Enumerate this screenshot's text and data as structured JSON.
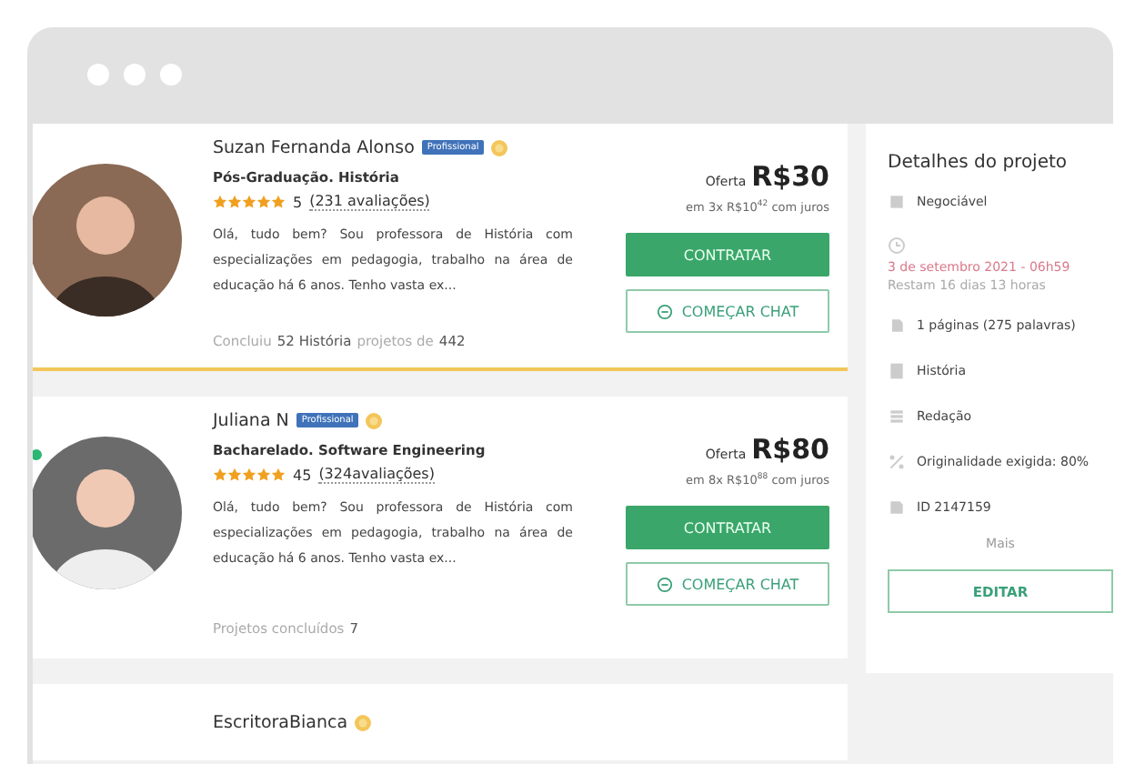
{
  "freelancers": [
    {
      "name": "Suzan Fernanda Alonso",
      "professional": true,
      "professional_label": "Profissional",
      "verified": true,
      "selected": true,
      "online": false,
      "degree": "Pós-Graduação. História",
      "stars": 5,
      "rating": "5",
      "reviews": "(231 avaliações)",
      "bio": "Olá, tudo bem? Sou professora de História com especializações em pedagogia, trabalho na área de educação há 6 anos. Tenho vasta ex...",
      "completed": [
        {
          "text": "Concluiu",
          "strong": false
        },
        {
          "text": "52 História",
          "strong": true
        },
        {
          "text": "projetos de",
          "strong": false
        },
        {
          "text": "442",
          "strong": true
        }
      ],
      "offer_label": "Oferta",
      "price": "R$30",
      "installments": "em 3x R$10$^{42}$ com juros",
      "hire": "CONTRATAR",
      "chat": "COMEÇAR CHAT"
    },
    {
      "name": "Juliana N",
      "professional": true,
      "professional_label": "Profissional",
      "verified": true,
      "selected": false,
      "online": true,
      "degree": "Bacharelado. Software Engineering",
      "stars": 5,
      "rating": "45",
      "reviews": "(324avaliações)",
      "bio": "Olá, tudo bem? Sou professora de História com especializações em pedagogia, trabalho na área de educação há 6 anos. Tenho vasta ex...",
      "completed": [
        {
          "text": "Projetos concluídos",
          "strong": false
        },
        {
          "text": "7",
          "strong": true
        }
      ],
      "offer_label": "Oferta",
      "price": "R$80",
      "installments": "em 8x R$10$^{88}$ com juros",
      "hire": "CONTRATAR",
      "chat": "COMEÇAR CHAT"
    },
    {
      "name": "EscritoraBianca",
      "professional": false,
      "verified": true,
      "selected": false,
      "online": false
    }
  ],
  "details": {
    "title": "Detalhes do projeto",
    "items": [
      {
        "kind": "budget",
        "text": "Negociável"
      },
      {
        "kind": "deadline",
        "date": "3 de setembro 2021 - 06h59",
        "remaining": "Restam 16 dias 13 horas"
      },
      {
        "kind": "pages",
        "text": "1 páginas (275 palavras)"
      },
      {
        "kind": "subject",
        "text": "História"
      },
      {
        "kind": "type",
        "text": "Redação"
      },
      {
        "kind": "originality",
        "text": "Originalidade exigida: 80%"
      },
      {
        "kind": "id",
        "text": "ID 2147159"
      }
    ],
    "more": "Mais",
    "edit": "EDITAR"
  }
}
